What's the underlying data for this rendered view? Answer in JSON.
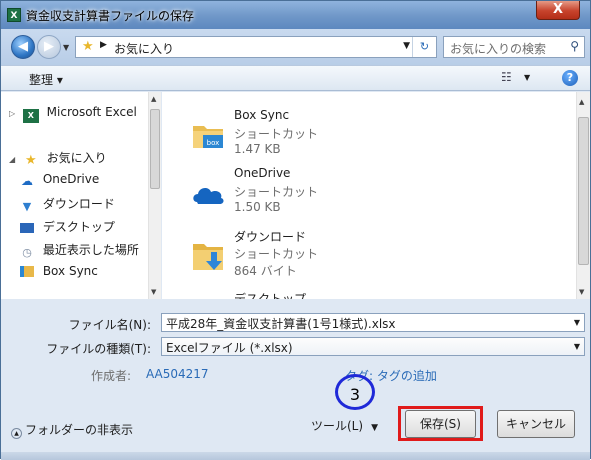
{
  "window": {
    "app_icon": "X",
    "title": "資金収支計算書ファイルの保存",
    "close_label": "X"
  },
  "nav": {
    "back_icon": "◀",
    "forward_icon": "▶",
    "breadcrumb_arrow": "▶",
    "breadcrumb": "お気に入り",
    "refresh_icon": "↻",
    "search_placeholder": "お気に入りの検索"
  },
  "toolbar": {
    "organize_label": "整理 ▾",
    "view_icon": "☷",
    "help_icon": "?"
  },
  "navpane": {
    "items": [
      {
        "label": "Microsoft Excel",
        "expander": "▷",
        "icon": "excel-icon"
      },
      {
        "label": "お気に入り",
        "expander": "◢",
        "icon": "star-icon"
      },
      {
        "label": "OneDrive",
        "expander": "",
        "icon": "cloud-icon"
      },
      {
        "label": "ダウンロード",
        "expander": "",
        "icon": "download-folder-icon"
      },
      {
        "label": "デスクトップ",
        "expander": "",
        "icon": "desktop-icon"
      },
      {
        "label": "最近表示した場所",
        "expander": "",
        "icon": "recent-places-icon"
      },
      {
        "label": "Box Sync",
        "expander": "",
        "icon": "box-folder-icon"
      }
    ]
  },
  "files": [
    {
      "name": "Box Sync",
      "type": "ショートカット",
      "size": "1.47 KB",
      "icon": "box-folder-icon"
    },
    {
      "name": "OneDrive",
      "type": "ショートカット",
      "size": "1.50 KB",
      "icon": "onedrive-cloud-icon"
    },
    {
      "name": "ダウンロード",
      "type": "ショートカット",
      "size": "864 バイト",
      "icon": "download-folder-icon"
    },
    {
      "name": "デスクトップ",
      "type": "",
      "size": "",
      "icon": "desktop-icon"
    }
  ],
  "form": {
    "filename_label": "ファイル名(N):",
    "filename_value": "平成28年_資金収支計算書(1号1様式).xlsx",
    "filetype_label": "ファイルの種類(T):",
    "filetype_value": "Excelファイル (*.xlsx)",
    "author_label": "作成者:",
    "author_value": "AA504217",
    "tags_label": "タグ:",
    "tags_link": "タグの追加",
    "marker_number": "3",
    "hide_folders_label": "フォルダーの非表示",
    "tools_label": "ツール(L)",
    "save_label": "保存(S)",
    "cancel_label": "キャンセル"
  },
  "colors": {
    "highlight_red": "#e01a1a",
    "marker_blue": "#1f29d8",
    "link_blue": "#2a6bb7"
  }
}
